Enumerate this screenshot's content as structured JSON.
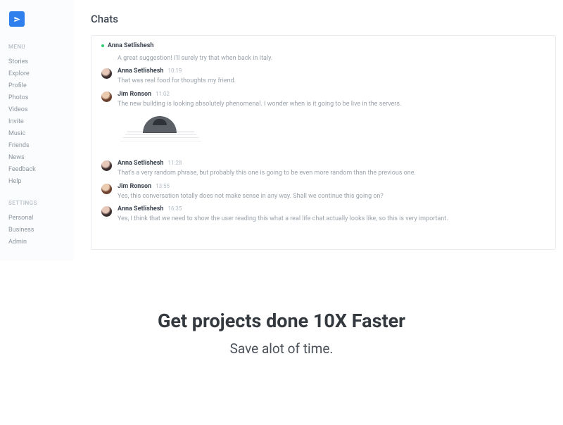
{
  "sidebar": {
    "menu_label": "MENU",
    "settings_label": "SETTINGS",
    "menu": [
      {
        "label": "Stories"
      },
      {
        "label": "Explore"
      },
      {
        "label": "Profile"
      },
      {
        "label": "Photos"
      },
      {
        "label": "Videos"
      },
      {
        "label": "Invite"
      },
      {
        "label": "Music"
      },
      {
        "label": "Friends"
      },
      {
        "label": "News"
      },
      {
        "label": "Feedback"
      },
      {
        "label": "Help"
      }
    ],
    "settings": [
      {
        "label": "Personal"
      },
      {
        "label": "Business"
      },
      {
        "label": "Admin"
      }
    ]
  },
  "page": {
    "title": "Chats",
    "active_user": "Anna Setlishesh",
    "messages": [
      {
        "type": "reply",
        "text": "A great suggestion! I'll surely try that when back in Italy."
      },
      {
        "type": "msg",
        "author": "Anna Setlishesh",
        "avatar": "anna",
        "time": "10:19",
        "text": "That was real food for thoughts my friend."
      },
      {
        "type": "msg",
        "author": "Jim Ronson",
        "avatar": "jim",
        "time": "11:02",
        "text": "The new building is looking absolutely phenomenal. I wonder when is it going to be live in the servers.",
        "attachment": "building"
      },
      {
        "type": "msg",
        "author": "Anna Setlishesh",
        "avatar": "anna",
        "time": "11:28",
        "text": "That's a very random phrase, but probably this one is going to be even more random than the previous one."
      },
      {
        "type": "msg",
        "author": "Jim Ronson",
        "avatar": "jim",
        "time": "13:55",
        "text": "Yes, this conversation totally does not make sense in any way. Shall we continue this going on?"
      },
      {
        "type": "msg",
        "author": "Anna Setlishesh",
        "avatar": "anna",
        "time": "16:35",
        "text": "Yes, I think that we need to show the user reading this what a real life chat actually looks like, so this is very important."
      }
    ]
  },
  "hero": {
    "title": "Get projects done 10X Faster",
    "sub": "Save alot of time."
  }
}
